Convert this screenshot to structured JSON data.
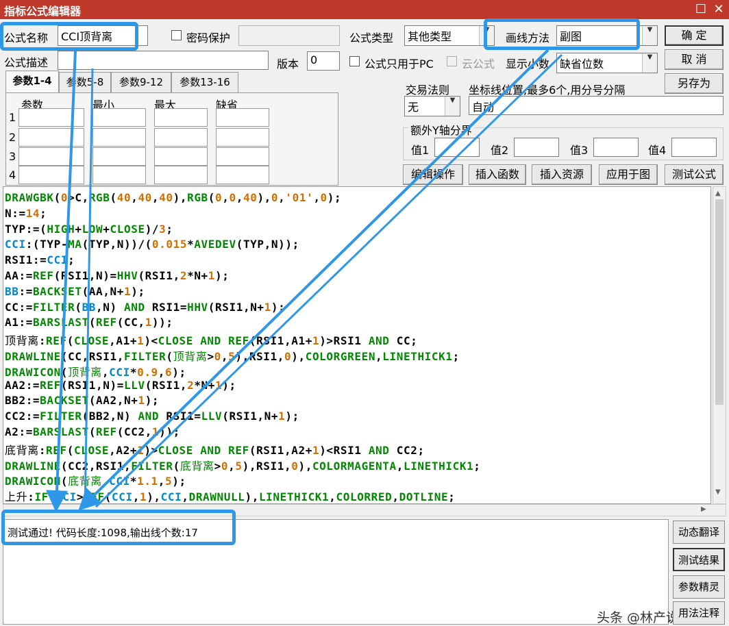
{
  "window": {
    "title": "指标公式编辑器",
    "restore_glyph": "☐",
    "close_glyph": "✕"
  },
  "form": {
    "name_label": "公式名称",
    "name_value": "CCI顶背离",
    "password_label": "密码保护",
    "type_label": "公式类型",
    "type_value": "其他类型",
    "draw_label": "画线方法",
    "draw_value": "副图",
    "desc_label": "公式描述",
    "desc_value": "",
    "version_label": "版本",
    "version_value": "0",
    "pc_only_label": "公式只用于PC",
    "cloud_label": "云公式",
    "decimals_label": "显示小数",
    "decimals_value": "缺省位数"
  },
  "buttons": {
    "ok": "确 定",
    "cancel": "取 消",
    "save_as": "另存为",
    "edit_op": "编辑操作",
    "insert_func": "插入函数",
    "insert_res": "插入资源",
    "apply": "应用于图",
    "test": "测试公式"
  },
  "tabs": [
    "参数1-4",
    "参数5-8",
    "参数9-12",
    "参数13-16"
  ],
  "params": {
    "headers": [
      "参数",
      "最小",
      "最大",
      "缺省"
    ],
    "rows": [
      "1",
      "2",
      "3",
      "4"
    ]
  },
  "trade": {
    "rule_label": "交易法则",
    "rule_value": "无",
    "coord_label": "坐标线位置,最多6个,用分号分隔",
    "coord_value": "自动"
  },
  "yaxis": {
    "group_label": "额外Y轴分界",
    "labels": [
      "值1",
      "值2",
      "值3",
      "值4"
    ]
  },
  "status": {
    "message": "测试通过! 代码长度:1098,输出线个数:17"
  },
  "side_buttons": [
    "动态翻译",
    "测试结果",
    "参数精灵",
    "用法注释"
  ],
  "watermark": "头条 @林产说",
  "code_lines": [
    "DRAWGBK(0>C,RGB(40,40,40),RGB(0,0,40),0,'01',0);",
    "N:=14;",
    "TYP:=(HIGH+LOW+CLOSE)/3;",
    "CCI:(TYP-MA(TYP,N))/(0.015*AVEDEV(TYP,N));",
    "RSI1:=CCI;",
    "AA:=REF(RSI1,N)=HHV(RSI1,2*N+1);",
    "BB:=BACKSET(AA,N+1);",
    "CC:=FILTER(BB,N) AND RSI1=HHV(RSI1,N+1);",
    "A1:=BARSLAST(REF(CC,1));",
    "顶背离:REF(CLOSE,A1+1)<CLOSE AND REF(RSI1,A1+1)>RSI1 AND CC;",
    "DRAWLINE(CC,RSI1,FILTER(顶背离>0,5),RSI1,0),COLORGREEN,LINETHICK1;",
    "DRAWICON(顶背离,CCI*0.9,6);",
    "AA2:=REF(RSI1,N)=LLV(RSI1,2*N+1);",
    "BB2:=BACKSET(AA2,N+1);",
    "CC2:=FILTER(BB2,N) AND RSI1=LLV(RSI1,N+1);",
    "A2:=BARSLAST(REF(CC2,1));",
    "底背离:REF(CLOSE,A2+1)>CLOSE AND REF(RSI1,A2+1)<RSI1 AND CC2;",
    "DRAWLINE(CC2,RSI1,FILTER(底背离>0,5),RSI1,0),COLORMAGENTA,LINETHICK1;",
    "DRAWICON(底背离,CCI*1.1,5);",
    "上升:IF(CCI>REF(CCI,1),CCI,DRAWNULL),LINETHICK1,COLORRED,DOTLINE;"
  ]
}
